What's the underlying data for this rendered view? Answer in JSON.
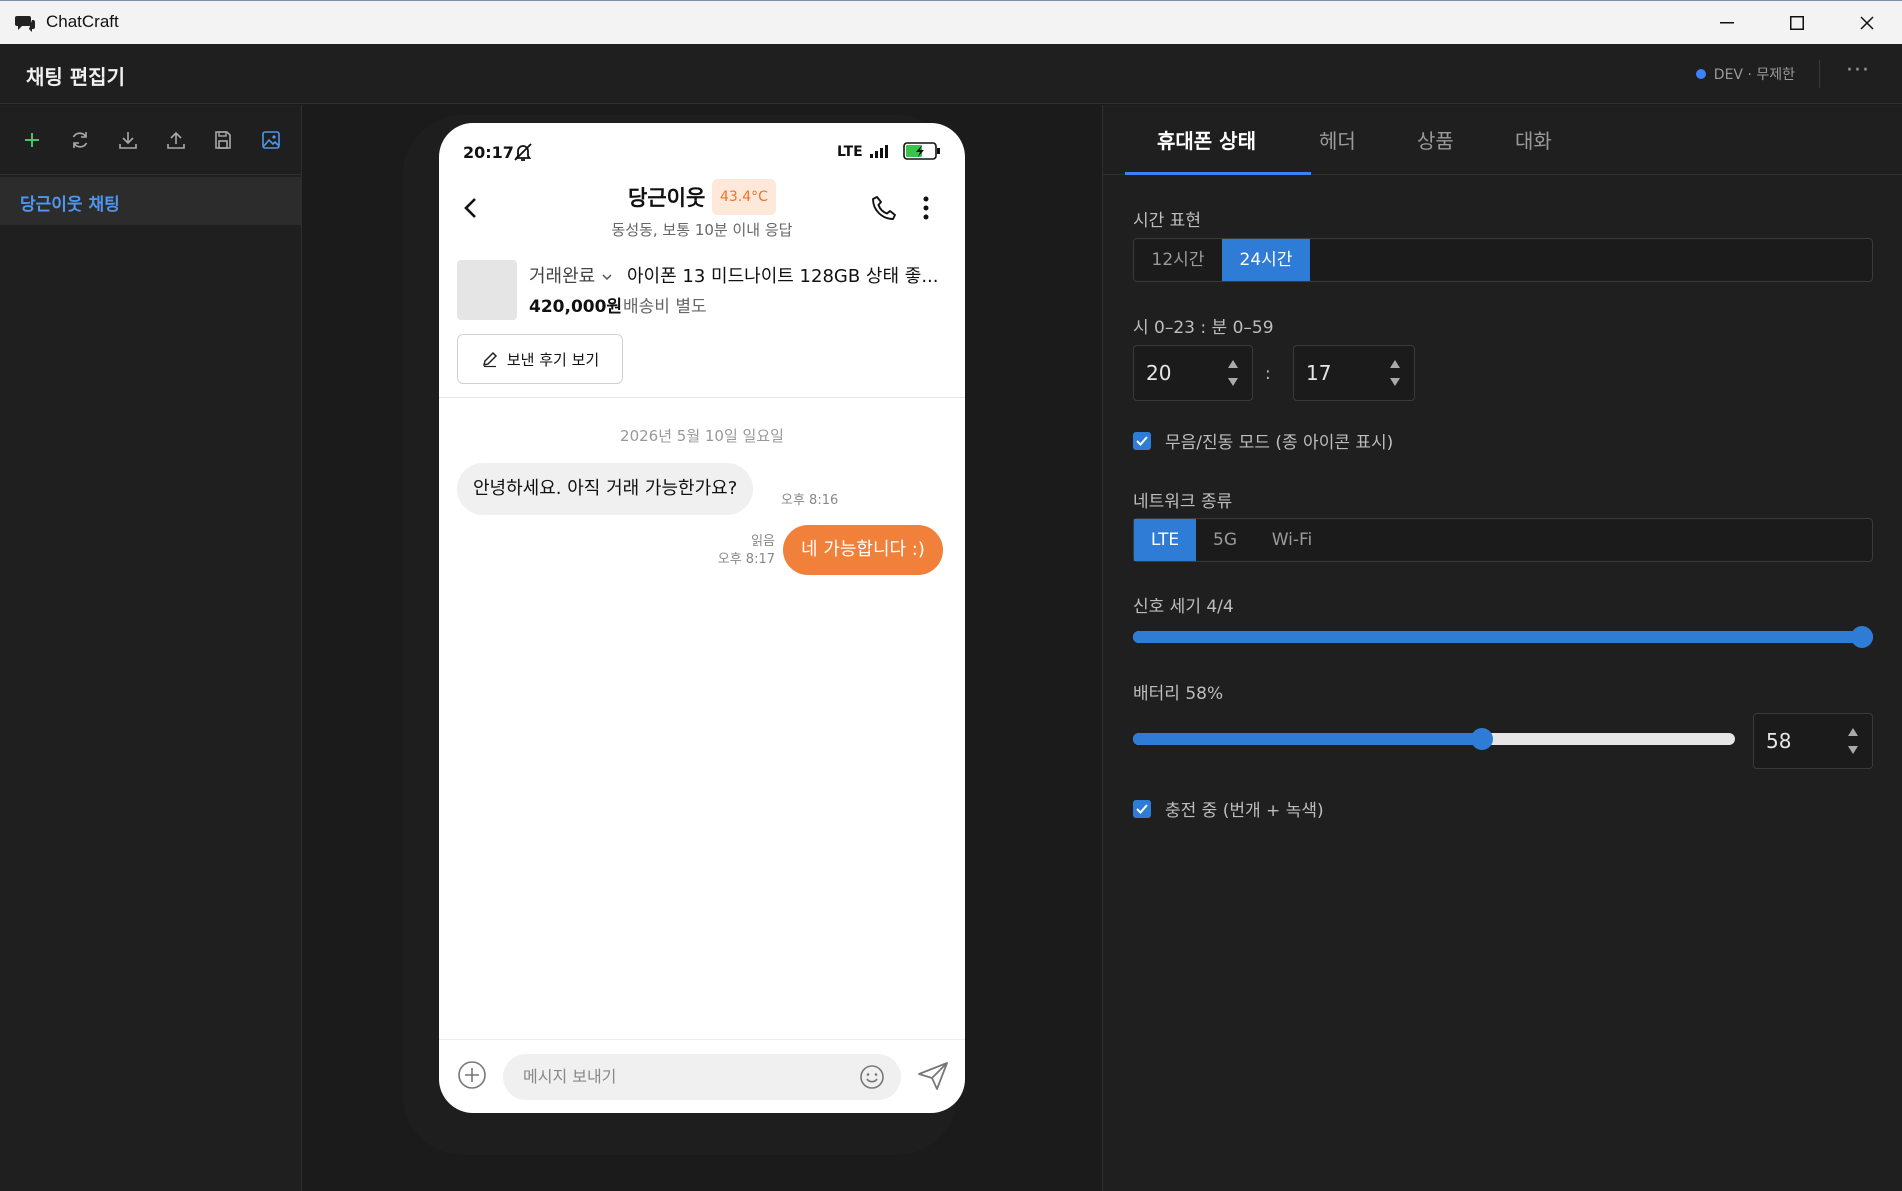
{
  "window": {
    "title": "ChatCraft"
  },
  "app": {
    "page_title": "채팅 편집기",
    "env_label": "DEV · 무제한",
    "more": "···"
  },
  "sidebar": {
    "tools": [
      "add-icon",
      "refresh-icon",
      "download-icon",
      "upload-icon",
      "save-icon",
      "image-icon"
    ],
    "items": [
      {
        "label": "당근이웃 채팅"
      }
    ]
  },
  "phone": {
    "status": {
      "time": "20:17",
      "network": "LTE"
    },
    "header": {
      "name": "당근이웃",
      "temperature": "43.4°C",
      "subtitle": "동성동, 보통 10분 이내 응답"
    },
    "product": {
      "status": "거래완료",
      "name": "아이폰 13 미드나이트 128GB 상태 좋...",
      "price": "420,000원",
      "shipping": "배송비 별도",
      "review_button": "보낸 후기 보기"
    },
    "chat": {
      "date": "2026년 5월 10일 일요일",
      "incoming": {
        "text": "안녕하세요. 아직 거래 가능한가요?",
        "time": "오후 8:16"
      },
      "outgoing": {
        "text": "네 가능합니다 :)",
        "read": "읽음",
        "time": "오후 8:17"
      }
    },
    "composer": {
      "placeholder": "메시지 보내기"
    }
  },
  "panel": {
    "tabs": [
      "휴대폰 상태",
      "헤더",
      "상품",
      "대화"
    ],
    "time_format": {
      "label": "시간 표현",
      "options": [
        "12시간",
        "24시간"
      ],
      "selected": "24시간"
    },
    "time_value": {
      "label": "시 0–23 : 분 0–59",
      "hour": "20",
      "separator": ":",
      "minute": "17"
    },
    "silent_mode": {
      "label": "무음/진동 모드 (종 아이콘 표시)",
      "checked": true
    },
    "network": {
      "label": "네트워크 종류",
      "options": [
        "LTE",
        "5G",
        "Wi-Fi"
      ],
      "selected": "LTE"
    },
    "signal": {
      "label": "신호 세기 4/4",
      "value": 4,
      "max": 4
    },
    "battery": {
      "label": "배터리 58%",
      "value": 58,
      "input_value": "58"
    },
    "charging": {
      "label": "충전 중 (번개 + 녹색)",
      "checked": true
    }
  },
  "colors": {
    "accent": "#2e7cd6",
    "orange": "#f0803a",
    "sidebar_active_text": "#4f96ee"
  }
}
